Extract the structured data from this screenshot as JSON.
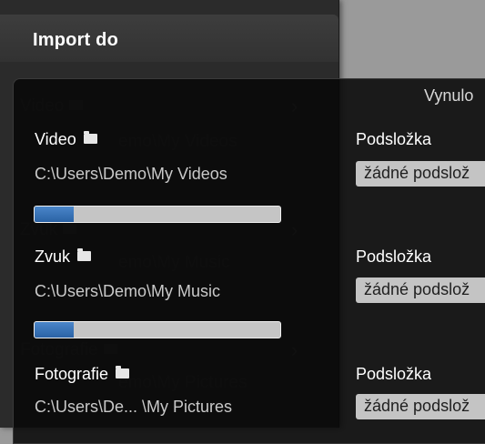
{
  "panel": {
    "title": "Import do"
  },
  "reset_label": "Vynulo",
  "sections": [
    {
      "title": "Video",
      "path": "C:\\Users\\Demo\\My Videos",
      "progress": 0.16,
      "subfolder_label": "Podsložka",
      "subfolder_value": "žádné podslož"
    },
    {
      "title": "Zvuk",
      "path": "C:\\Users\\Demo\\My Music",
      "progress": 0.16,
      "subfolder_label": "Podsložka",
      "subfolder_value": "žádné podslož"
    },
    {
      "title": "Fotografie",
      "path": "C:\\Users\\De... \\My Pictures",
      "progress": 0.16,
      "subfolder_label": "Podsložka",
      "subfolder_value": "žádné podslož"
    }
  ],
  "colors": {
    "progress_fill": "#2f6bb0",
    "dropdown_bg": "#c4c4c4",
    "overlay_bg": "#080808"
  },
  "icons": {
    "folder": "folder-icon"
  }
}
